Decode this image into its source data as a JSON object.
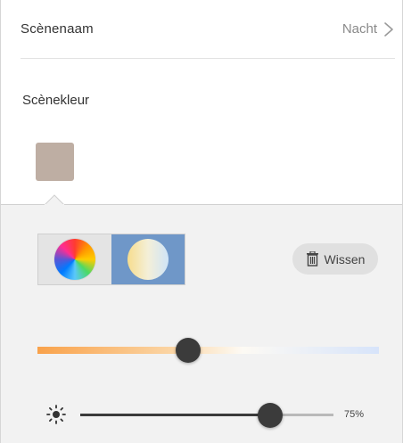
{
  "scene": {
    "name_label": "Scènenaam",
    "name_value": "Nacht",
    "color_label": "Scènekleur",
    "swatch_color": "#beaea3"
  },
  "mode_toggle": {
    "options": [
      "color-wheel",
      "white-temperature"
    ],
    "selected": "white-temperature",
    "active_color": "#6f97c8"
  },
  "clear_button": {
    "label": "Wissen",
    "icon": "trash-icon"
  },
  "temperature": {
    "level": 0.44
  },
  "brightness": {
    "icon": "sun-icon",
    "level": 0.75,
    "value_label": "75%"
  }
}
